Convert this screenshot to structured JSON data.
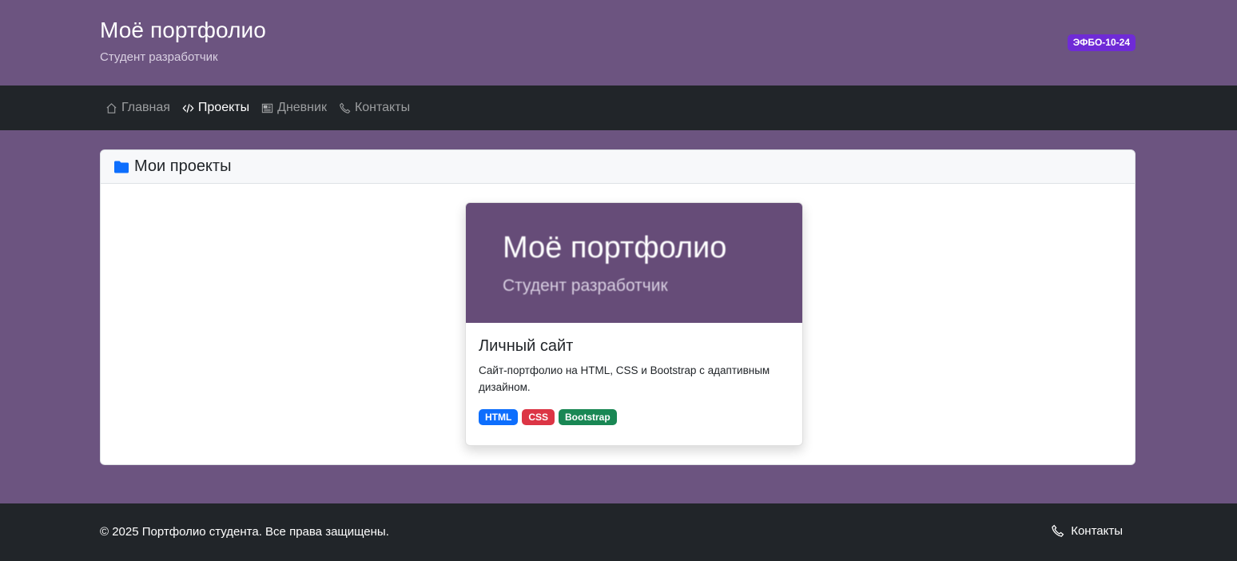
{
  "header": {
    "title": "Моё портфолио",
    "subtitle": "Студент разработчик",
    "badge": "ЭФБО-10-24"
  },
  "nav": {
    "items": [
      {
        "label": "Главная",
        "icon": "house-icon",
        "active": false
      },
      {
        "label": "Проекты",
        "icon": "code-icon",
        "active": true
      },
      {
        "label": "Дневник",
        "icon": "journal-icon",
        "active": false
      },
      {
        "label": "Контакты",
        "icon": "telephone-icon",
        "active": false
      }
    ]
  },
  "projects": {
    "title": "Мои проекты",
    "icon": "folder-icon",
    "cards": [
      {
        "thumbnail": {
          "title": "Моё портфолио",
          "subtitle": "Студент разработчик"
        },
        "title": "Личный сайт",
        "description": "Сайт-портфолио на HTML, CSS и Bootstrap с адаптивным дизайном.",
        "tags": [
          {
            "label": "HTML",
            "color": "#0d6efd"
          },
          {
            "label": "CSS",
            "color": "#dc3545"
          },
          {
            "label": "Bootstrap",
            "color": "#198754"
          }
        ]
      }
    ]
  },
  "footer": {
    "copyright": "© 2025 Портфолио студента. Все права защищены.",
    "contacts_label": "Контакты",
    "contacts_icon": "telephone-icon"
  },
  "colors": {
    "page_bg": "#6c5480",
    "dark_bar": "#212529",
    "badge": "#6f2bd6",
    "folder": "#0d6efd"
  }
}
